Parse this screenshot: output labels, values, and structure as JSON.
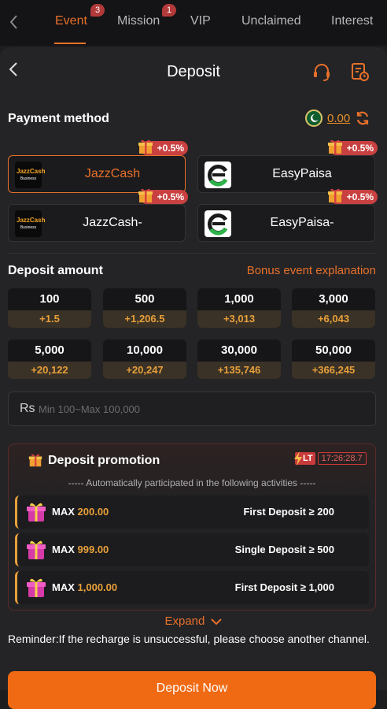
{
  "topnav": {
    "tabs": [
      {
        "label": "Event",
        "badge": "3"
      },
      {
        "label": "Mission",
        "badge": "1"
      },
      {
        "label": "VIP"
      },
      {
        "label": "Unclaimed"
      },
      {
        "label": "Interest"
      }
    ]
  },
  "header": {
    "title": "Deposit"
  },
  "payment": {
    "title": "Payment method",
    "balance": "0.00",
    "methods": [
      {
        "name": "JazzCash",
        "bonus": "+0.5%",
        "logo_text": "JazzCash",
        "logo_sub": "Business"
      },
      {
        "name": "EasyPaisa",
        "bonus": "+0.5%"
      },
      {
        "name": "JazzCash-",
        "bonus": "+0.5%",
        "logo_text": "JazzCash",
        "logo_sub": "Business"
      },
      {
        "name": "EasyPaisa-",
        "bonus": "+0.5%"
      }
    ]
  },
  "amount": {
    "title": "Deposit amount",
    "bonus_link": "Bonus event explanation",
    "options": [
      {
        "value": "100",
        "bonus": "+1.5"
      },
      {
        "value": "500",
        "bonus": "+1,206.5"
      },
      {
        "value": "1,000",
        "bonus": "+3,013"
      },
      {
        "value": "3,000",
        "bonus": "+6,043"
      },
      {
        "value": "5,000",
        "bonus": "+20,122"
      },
      {
        "value": "10,000",
        "bonus": "+20,247"
      },
      {
        "value": "30,000",
        "bonus": "+135,746"
      },
      {
        "value": "50,000",
        "bonus": "+366,245"
      }
    ],
    "currency": "Rs",
    "placeholder": "Min 100~Max 100,000"
  },
  "promotion": {
    "title": "Deposit promotion",
    "lt_label": "LT",
    "timer": "17:26:28.7",
    "subtitle": "----- Automatically participated in the following activities -----",
    "items": [
      {
        "max_label": "MAX",
        "max_value": "200.00",
        "condition": "First Deposit ≥ 200"
      },
      {
        "max_label": "MAX",
        "max_value": "999.00",
        "condition": "Single Deposit ≥ 500"
      },
      {
        "max_label": "MAX",
        "max_value": "1,000.00",
        "condition": "First Deposit ≥ 1,000"
      }
    ]
  },
  "expand_label": "Expand",
  "reminder": "Reminder:If the recharge is unsuccessful, please choose another channel.",
  "cta_label": "Deposit Now",
  "colors": {
    "accent": "#e8702a",
    "bonus": "#e8a03a",
    "badge": "#c94040"
  }
}
